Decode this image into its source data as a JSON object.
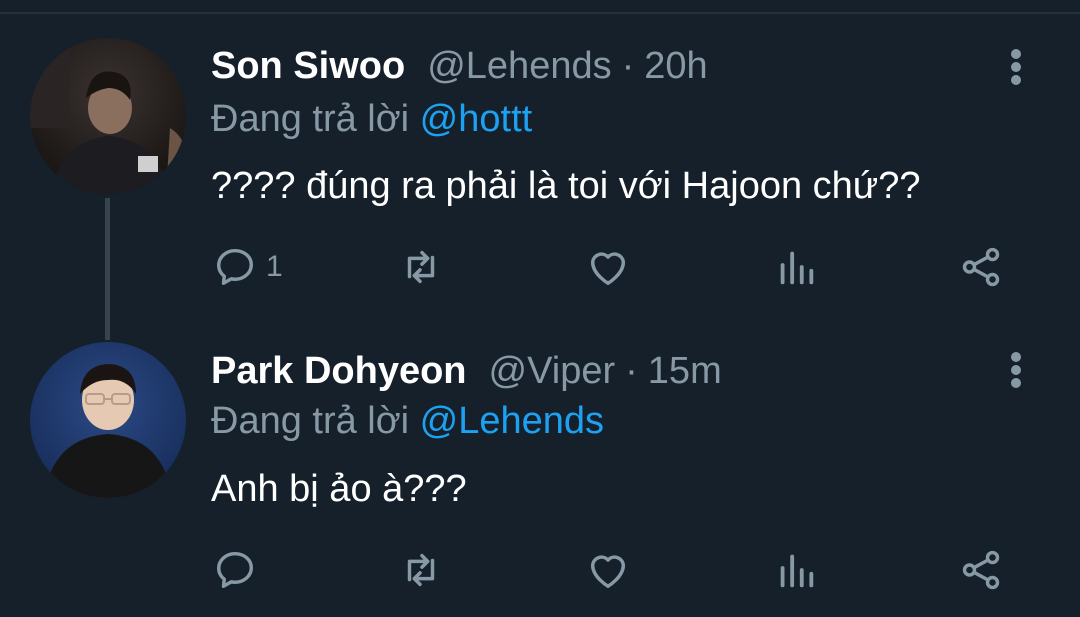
{
  "tweets": [
    {
      "name": "Son Siwoo",
      "handle": "@Lehends",
      "separator": "·",
      "time": "20h",
      "reply_prefix": "Đang trả lời",
      "reply_to": "@hottt",
      "text": "???? đúng ra phải là toi với Hajoon chứ??",
      "reply_count": "1"
    },
    {
      "name": "Park Dohyeon",
      "handle": "@Viper",
      "separator": "·",
      "time": "15m",
      "reply_prefix": "Đang trả lời",
      "reply_to": "@Lehends",
      "text": "Anh bị ảo à???",
      "reply_count": ""
    }
  ],
  "colors": {
    "background": "#15202b",
    "secondary_text": "#8899a6",
    "accent": "#1da1f2",
    "icon": "#8899a6"
  },
  "icons": [
    "avatar",
    "more-vertical-icon",
    "reply-icon",
    "retweet-icon",
    "like-icon",
    "analytics-icon",
    "share-icon"
  ]
}
